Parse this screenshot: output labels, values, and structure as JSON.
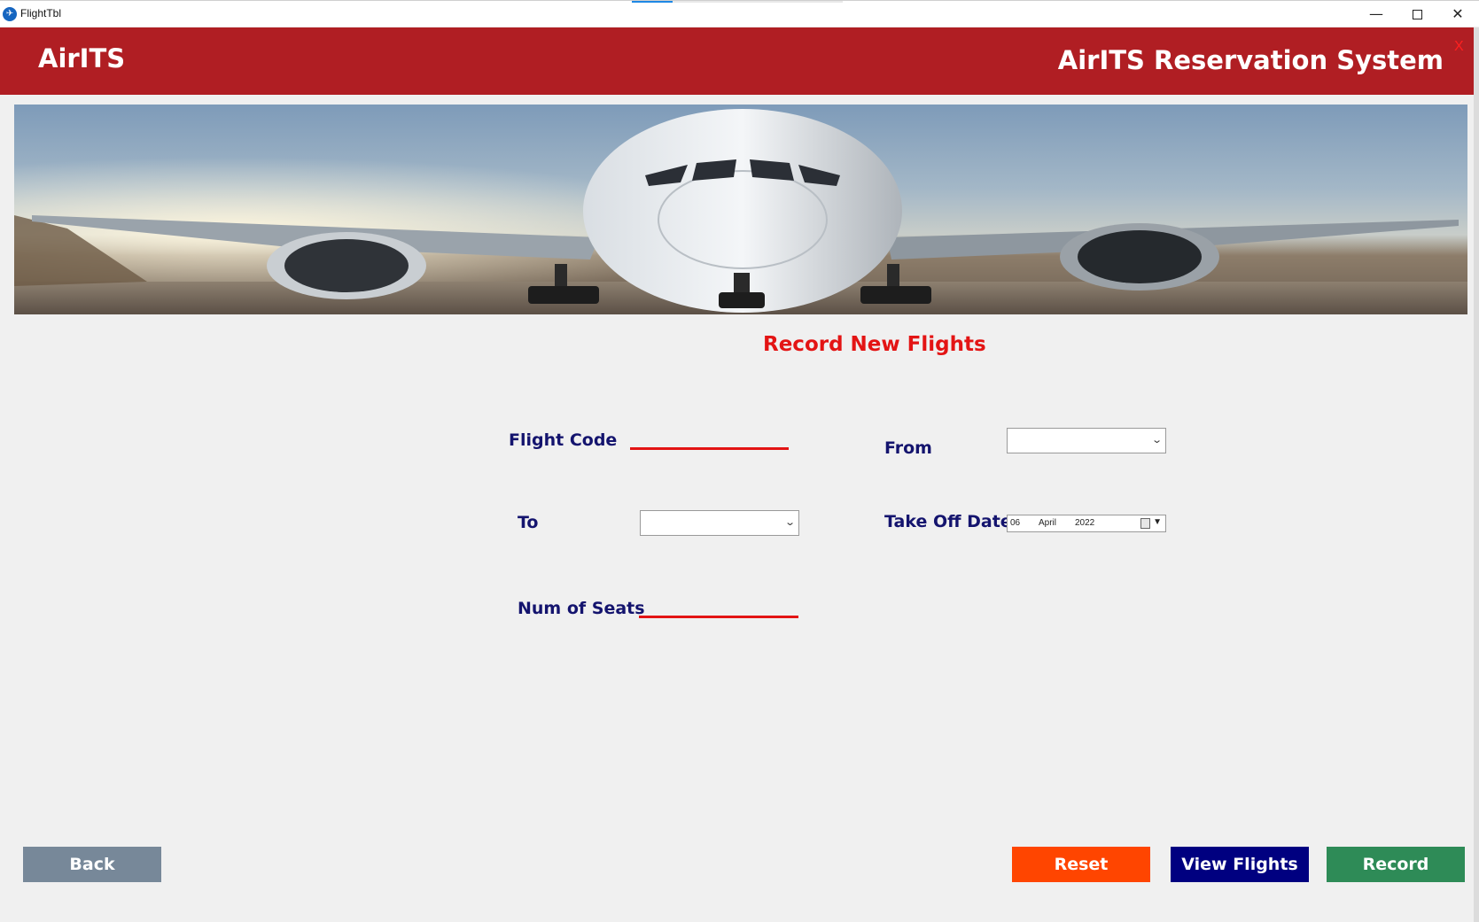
{
  "window": {
    "title": "FlightTbl",
    "app_icon": "airplane-icon",
    "minimize_glyph": "—",
    "close_glyph": "✕"
  },
  "header": {
    "brand": "AirITS",
    "title": "AirITS Reservation System",
    "close_label": "X",
    "background_color": "#b01e23"
  },
  "banner": {
    "image": "airplane-front-view-on-runway"
  },
  "form": {
    "title": "Record New Flights",
    "flight_code": {
      "label": "Flight Code",
      "value": ""
    },
    "from": {
      "label": "From",
      "selected": ""
    },
    "to": {
      "label": "To",
      "selected": ""
    },
    "take_off_date": {
      "label": "Take Off Date",
      "day": "06",
      "month": "April",
      "year": "2022"
    },
    "num_of_seats": {
      "label": "Num of Seats",
      "value": ""
    }
  },
  "buttons": {
    "back": "Back",
    "reset": "Reset",
    "view_flights": "View Flights",
    "record": "Record"
  },
  "colors": {
    "accent_red": "#e31414",
    "label_navy": "#14146e",
    "back": "#778899",
    "reset": "#ff4500",
    "view": "#000080",
    "record": "#2e8b57"
  }
}
